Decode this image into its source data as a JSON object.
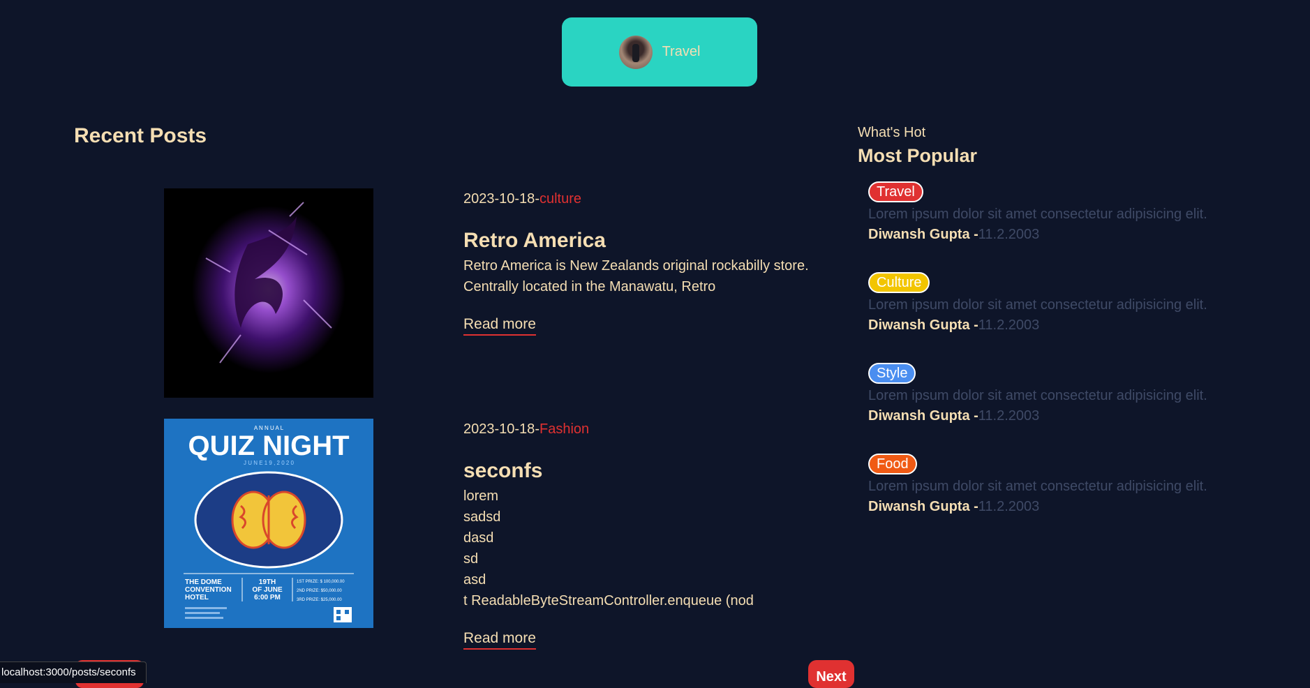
{
  "category_pill": {
    "label": "Travel"
  },
  "recent": {
    "title": "Recent Posts",
    "posts": [
      {
        "date": "2023-10-18",
        "separator": "-",
        "category": "culture",
        "title": "Retro America",
        "desc": "Retro America is New Zealands original rockabilly store.\nCentrally located in the Manawatu, Retro",
        "read_more": "Read more"
      },
      {
        "date": "2023-10-18",
        "separator": "-",
        "category": "Fashion",
        "title": "seconfs",
        "desc": "lorem\nsadsd\ndasd\nsd\nasd\nt ReadableByteStreamController.enqueue (nod",
        "read_more": "Read more"
      }
    ]
  },
  "quiz_poster": {
    "annual": "A N N U A L",
    "title": "QUIZ NIGHT",
    "date": "J U N E   1 9 ,  2 0 2 0",
    "venue": "THE DOME\nCONVENTION\nHOTEL",
    "when": "19TH\nOF JUNE\n6:00 PM",
    "prizes": "1ST PRIZE: $ 100,000.00\n2ND PRIZE: $50,000.00\n3RD PRIZE: $25,000.00"
  },
  "sidebar": {
    "subtitle": "What's Hot",
    "title": "Most Popular",
    "items": [
      {
        "tag": "Travel",
        "color": "#e03131",
        "desc": "Lorem ipsum dolor sit amet consectetur adipisicing elit.",
        "author": "Diwansh Gupta -",
        "date": "11.2.2003"
      },
      {
        "tag": "Culture",
        "color": "#f2c500",
        "desc": "Lorem ipsum dolor sit amet consectetur adipisicing elit.",
        "author": "Diwansh Gupta -",
        "date": "11.2.2003"
      },
      {
        "tag": "Style",
        "color": "#4a8ef0",
        "desc": "Lorem ipsum dolor sit amet consectetur adipisicing elit.",
        "author": "Diwansh Gupta -",
        "date": "11.2.2003"
      },
      {
        "tag": "Food",
        "color": "#f05a14",
        "desc": "Lorem ipsum dolor sit amet consectetur adipisicing elit.",
        "author": "Diwansh Gupta -",
        "date": "11.2.2003"
      }
    ]
  },
  "pagination": {
    "next": "Next"
  },
  "status_bar": {
    "url": "localhost:3000/posts/seconfs"
  }
}
